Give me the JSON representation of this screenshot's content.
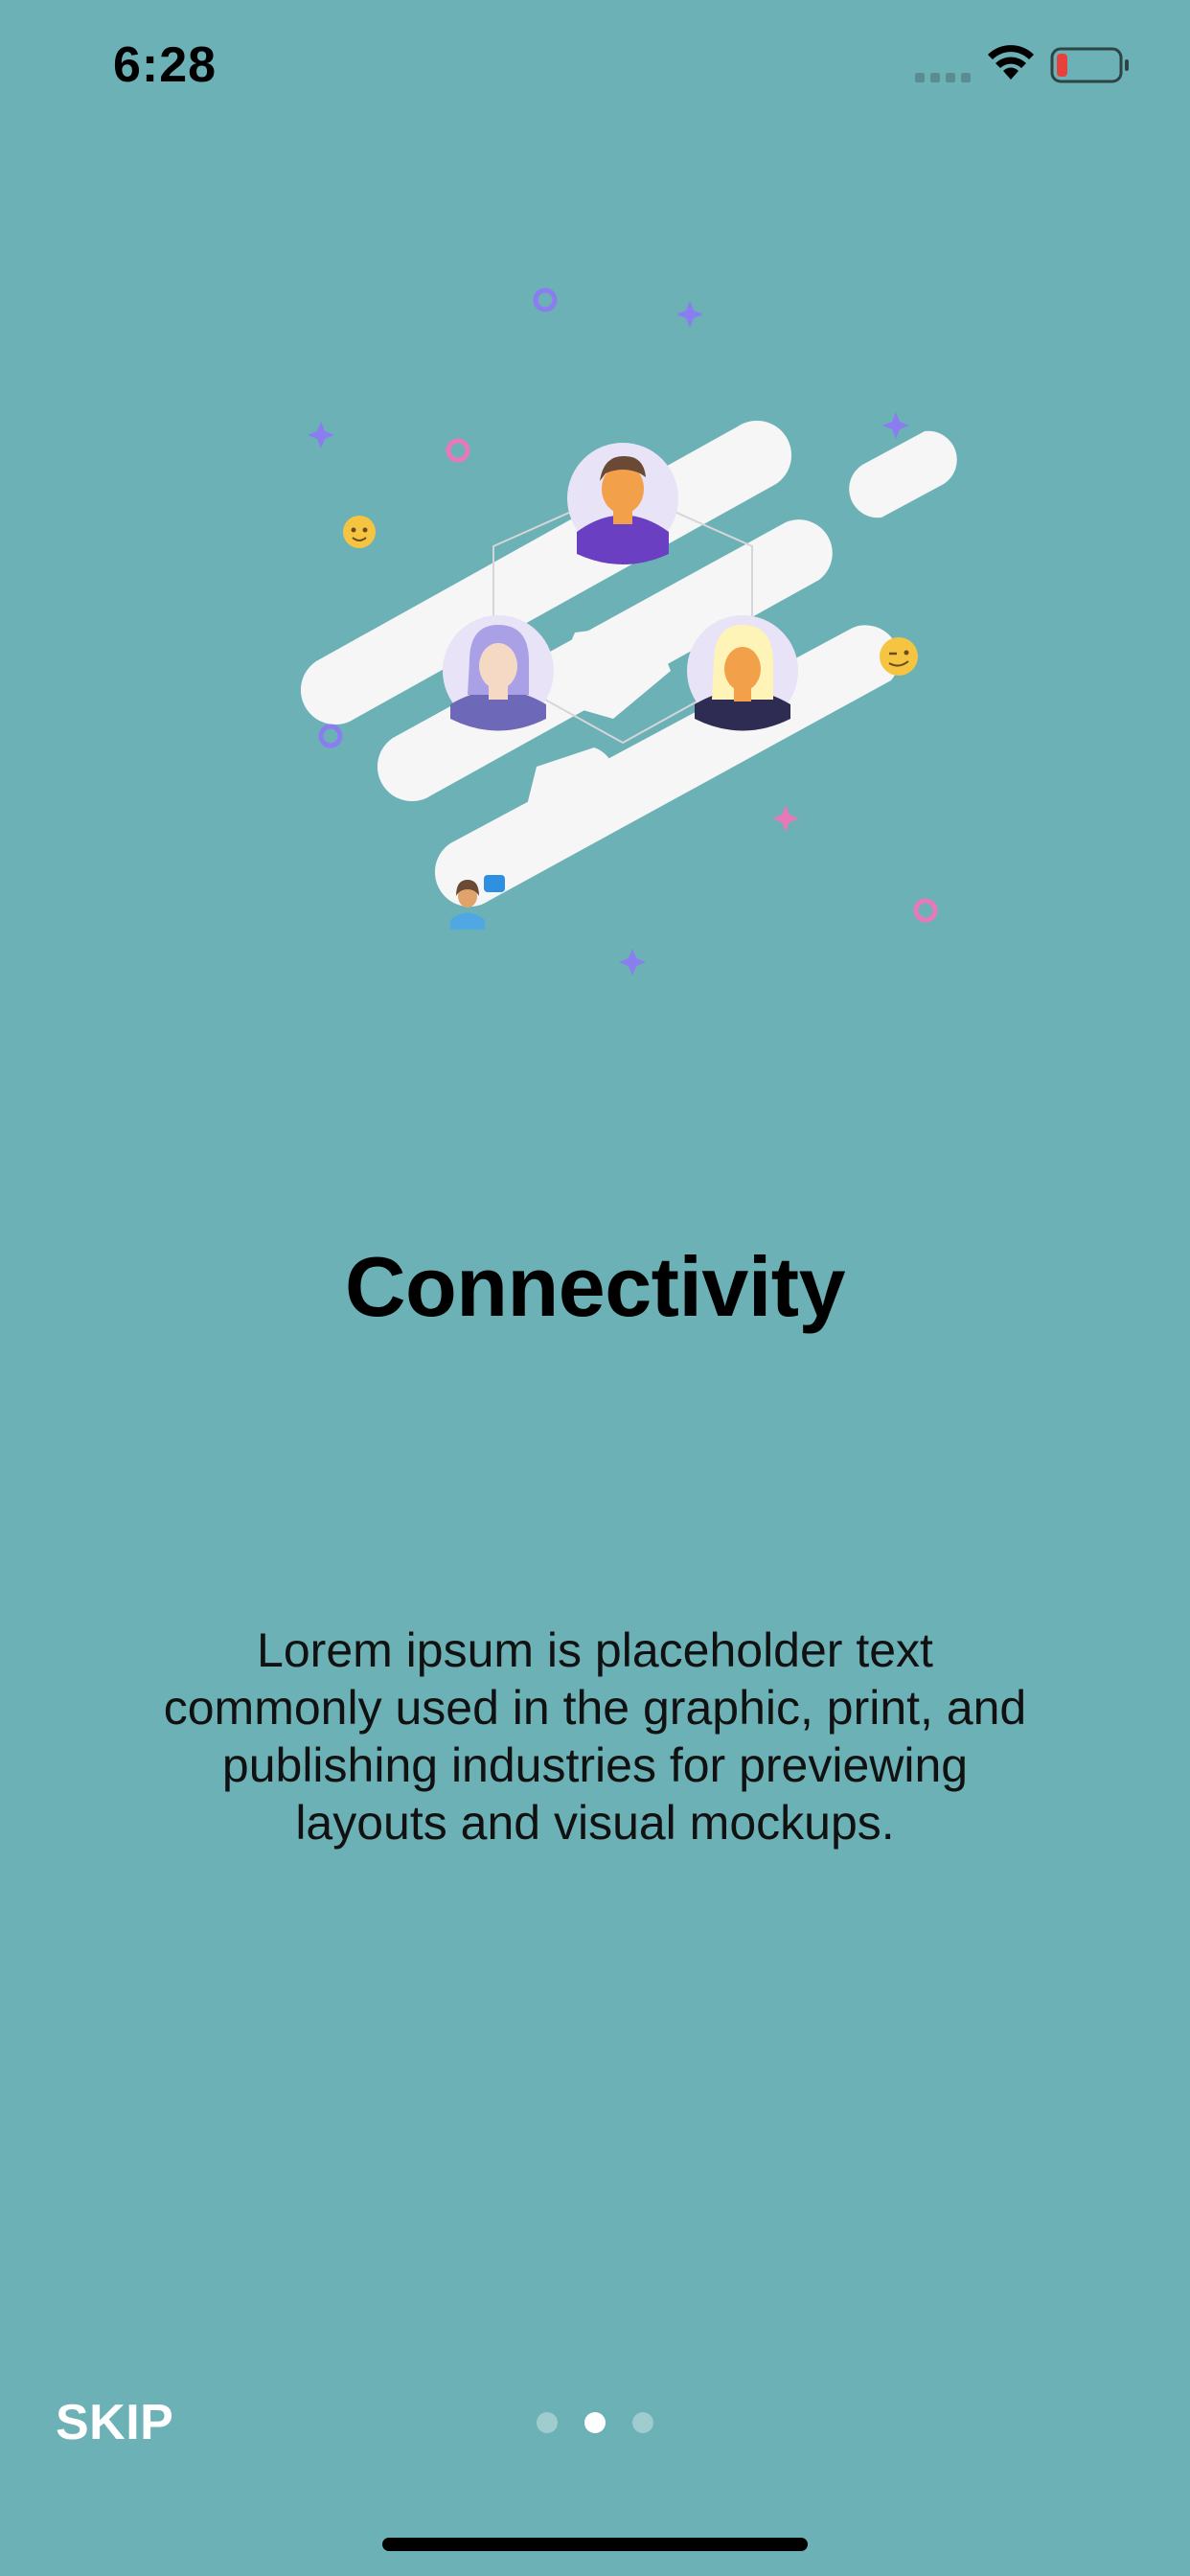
{
  "status_bar": {
    "time": "6:28",
    "icons": [
      "cellular-signal-icon",
      "wifi-icon",
      "battery-low-icon"
    ],
    "battery_color": "#e8413c"
  },
  "illustration": {
    "name": "connectivity-illustration",
    "accent_purple": "#8b7cf0",
    "accent_pink": "#e879b8",
    "blob_color": "#f6f6f7"
  },
  "onboarding": {
    "title": "Connectivity",
    "description": "Lorem ipsum is placeholder text commonly used in the graphic, print, and publishing industries for previewing layouts and visual mockups."
  },
  "footer": {
    "skip_label": "SKIP",
    "page_count": 3,
    "active_page": 2
  },
  "colors": {
    "background": "#6bb1b6",
    "text": "#000000",
    "skip": "#ffffff"
  }
}
